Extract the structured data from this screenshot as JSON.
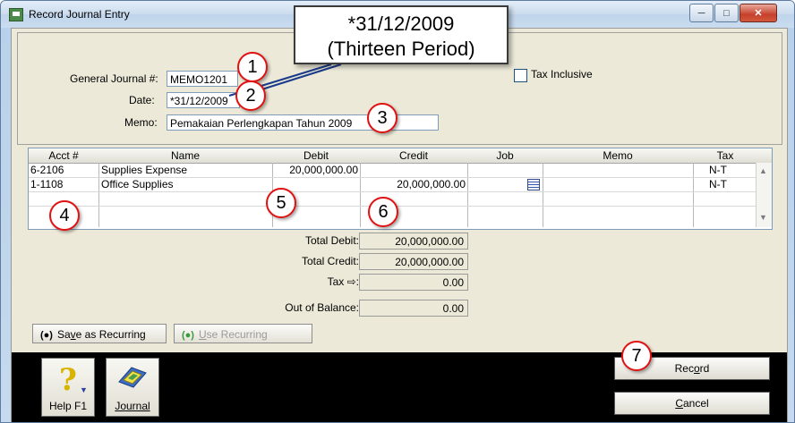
{
  "window": {
    "title": "Record Journal Entry",
    "controls": [
      "minimize-icon",
      "maximize-icon",
      "close-icon"
    ]
  },
  "form": {
    "general_journal_label": "General Journal #:",
    "general_journal_value": "MEMO1201",
    "date_label": "Date:",
    "date_value": "*31/12/2009",
    "memo_label": "Memo:",
    "memo_value": "Pemakaian Perlengkapan Tahun 2009",
    "tax_inclusive_label": "Tax Inclusive",
    "tax_inclusive_checked": false
  },
  "grid": {
    "columns": [
      "Acct #",
      "Name",
      "Debit",
      "Credit",
      "Job",
      "Memo",
      "Tax"
    ],
    "rows": [
      {
        "acct": "6-2106",
        "name": "Supplies Expense",
        "debit": "20,000,000.00",
        "credit": "",
        "job": "",
        "memo": "",
        "tax": "N-T"
      },
      {
        "acct": "1-1108",
        "name": "Office Supplies",
        "debit": "",
        "credit": "20,000,000.00",
        "job": "list-icon",
        "memo": "",
        "tax": "N-T"
      }
    ]
  },
  "totals": {
    "total_debit_label": "Total Debit:",
    "total_debit": "20,000,000.00",
    "total_credit_label": "Total Credit:",
    "total_credit": "20,000,000.00",
    "tax_label": "Tax ⇨:",
    "tax": "0.00",
    "out_of_balance_label": "Out of Balance:",
    "out_of_balance": "0.00"
  },
  "buttons": {
    "save_recurring_prefix": "Sa",
    "save_recurring_u": "v",
    "save_recurring_rest": "e as Recurring",
    "use_recurring_u": "U",
    "use_recurring_rest": "se Recurring",
    "help_label": "Help F1",
    "journal_label": "Journal",
    "record_prefix": "Rec",
    "record_u": "o",
    "record_rest": "rd",
    "cancel_prefix": "",
    "cancel_u": "C",
    "cancel_rest": "ancel"
  },
  "callouts": {
    "bubble_line1": "*31/12/2009",
    "bubble_line2": "(Thirteen Period)",
    "n1": "1",
    "n2": "2",
    "n3": "3",
    "n4": "4",
    "n5": "5",
    "n6": "6",
    "n7": "7"
  },
  "colors": {
    "callout_border": "#e01212",
    "panel_bg": "#ece9d8",
    "toolbar_bg": "#000000"
  }
}
